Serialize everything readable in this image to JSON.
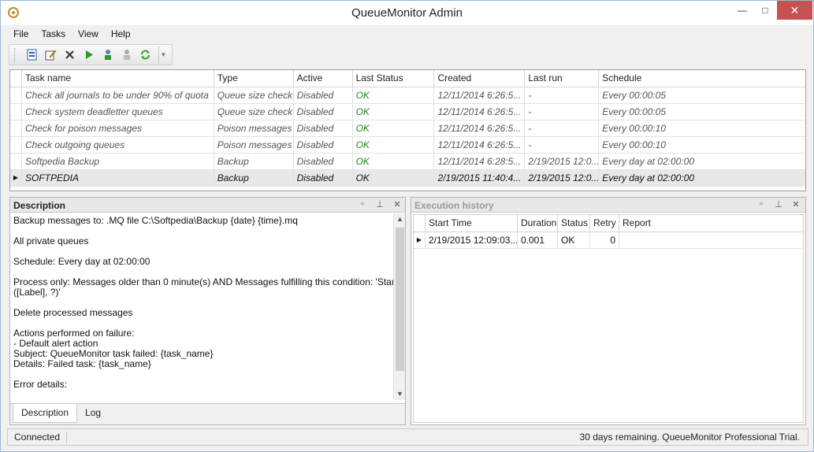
{
  "window": {
    "title": "QueueMonitor Admin"
  },
  "menu": [
    "File",
    "Tasks",
    "View",
    "Help"
  ],
  "toolbar": {
    "icons": [
      "new-task-icon",
      "edit-icon",
      "delete-icon",
      "run-icon",
      "run-all-icon",
      "stop-icon",
      "refresh-icon"
    ],
    "colors": {
      "run": "#2e9a2e",
      "refresh": "#2e9a2e",
      "delete": "#333333",
      "new": "#2a5ab0"
    }
  },
  "tasks": {
    "columns": [
      "Task name",
      "Type",
      "Active",
      "Last Status",
      "Created",
      "Last run",
      "Schedule"
    ],
    "rows": [
      {
        "name": "Check all journals to be under 90% of quota",
        "type": "Queue size check",
        "active": "Disabled",
        "last_status": "OK",
        "created": "12/11/2014 6:26:5...",
        "last_run": "-",
        "schedule": "Every 00:00:05"
      },
      {
        "name": "Check system deadletter queues",
        "type": "Queue size check",
        "active": "Disabled",
        "last_status": "OK",
        "created": "12/11/2014 6:26:5...",
        "last_run": "-",
        "schedule": "Every 00:00:05"
      },
      {
        "name": "Check for poison messages",
        "type": "Poison messages",
        "active": "Disabled",
        "last_status": "OK",
        "created": "12/11/2014 6:26:5...",
        "last_run": "-",
        "schedule": "Every 00:00:10"
      },
      {
        "name": "Check outgoing queues",
        "type": "Poison messages",
        "active": "Disabled",
        "last_status": "OK",
        "created": "12/11/2014 6:26:5...",
        "last_run": "-",
        "schedule": "Every 00:00:10"
      },
      {
        "name": "Softpedia Backup",
        "type": "Backup",
        "active": "Disabled",
        "last_status": "OK",
        "created": "12/11/2014 6:28:5...",
        "last_run": "2/19/2015 12:0...",
        "schedule": "Every day at 02:00:00"
      },
      {
        "name": "SOFTPEDIA",
        "type": "Backup",
        "active": "Disabled",
        "last_status": "OK",
        "created": "2/19/2015 11:40:4...",
        "last_run": "2/19/2015 12:0...",
        "schedule": "Every day at 02:00:00",
        "selected": true
      }
    ],
    "status_ok_color": "#1d8a1d"
  },
  "description": {
    "title": "Description",
    "lines": [
      "Backup messages to: .MQ file C:\\Softpedia\\Backup {date} {time}.mq",
      "",
      "All private queues",
      "",
      "Schedule: Every day at 02:00:00",
      "",
      "Process only: Messages older than 0 minute(s) AND Messages fulfilling this condition: 'StartsWith",
      "([Label], ?)'",
      "",
      "Delete processed messages",
      "",
      "Actions performed on failure:",
      "- Default alert action",
      "Subject: QueueMonitor task failed: {task_name}",
      "Details: Failed task: {task_name}",
      "",
      "Error details:"
    ],
    "tabs": [
      "Description",
      "Log"
    ]
  },
  "execution": {
    "title": "Execution history",
    "columns": [
      "Start Time",
      "Duration",
      "Status",
      "Retry",
      "Report"
    ],
    "rows": [
      {
        "start": "2/19/2015 12:09:03...",
        "duration": "0.001",
        "status": "OK",
        "retry": "0",
        "report": ""
      }
    ]
  },
  "statusbar": {
    "left": "Connected",
    "right": "30 days remaining. QueueMonitor Professional Trial."
  }
}
